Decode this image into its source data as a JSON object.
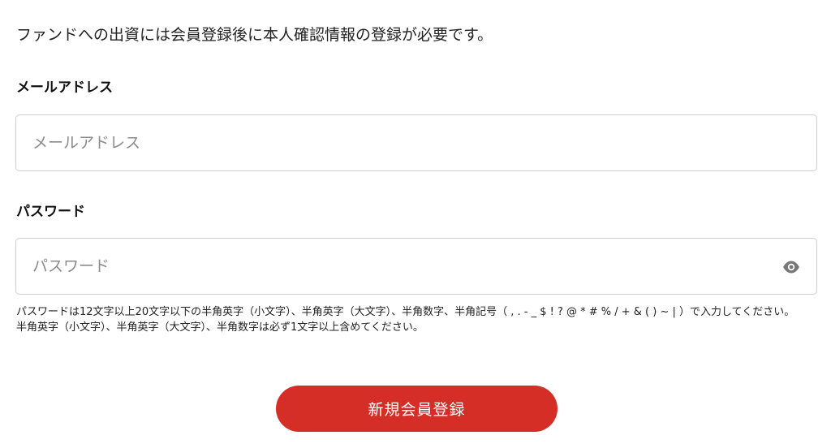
{
  "intro_text": "ファンドへの出資には会員登録後に本人確認情報の登録が必要です。",
  "email": {
    "label": "メールアドレス",
    "placeholder": "メールアドレス",
    "value": ""
  },
  "password": {
    "label": "パスワード",
    "placeholder": "パスワード",
    "value": "",
    "toggle_icon": "eye-icon",
    "help_line1": "パスワードは12文字以上20文字以下の半角英字（小文字）、半角英字（大文字）、半角数字、半角記号（ , . - _ $ ! ? @ * # % / + & ( ) ~ | ）で入力してください。",
    "help_line2": "半角英字（小文字）、半角英字（大文字）、半角数字は必ず1文字以上含めてください。"
  },
  "submit_label": "新規会員登録",
  "colors": {
    "primary": "#d42e26",
    "border": "#cfcfcf",
    "placeholder": "#8a8a8a",
    "icon": "#777777"
  }
}
